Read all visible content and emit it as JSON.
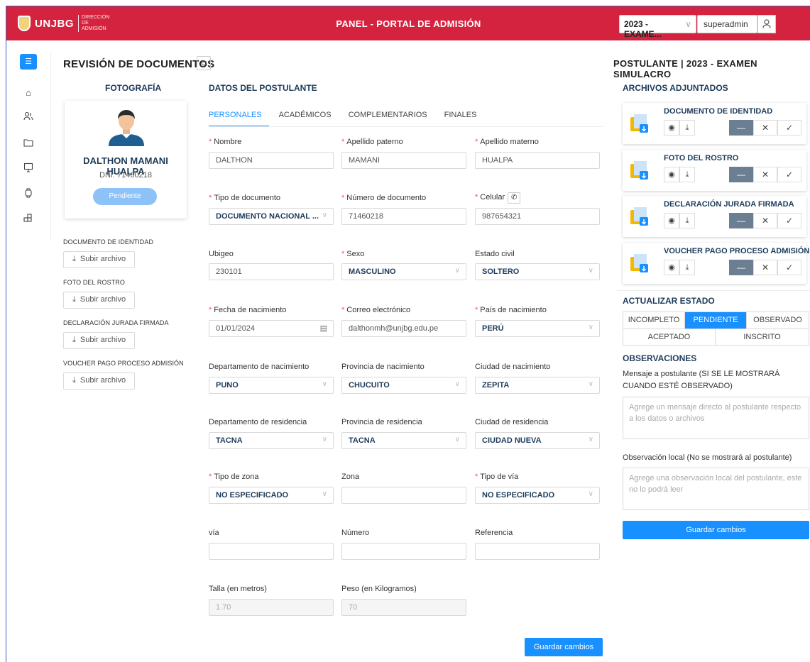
{
  "header": {
    "logo_text": "UNJBG",
    "logo_sub": "DIRECCIÓN DE ADMISIÓN",
    "title": "PANEL - PORTAL DE ADMISIÓN",
    "process_select": "2023 - EXAME...",
    "user": "superadmin"
  },
  "page": {
    "title": "REVISIÓN DE DOCUMENTOS",
    "photo_heading": "FOTOGRAFÍA",
    "data_heading": "DATOS DEL POSTULANTE"
  },
  "student": {
    "name": "DALTHON MAMANI HUALPA",
    "dni": "DNI: 71460218",
    "status": "Pendiente"
  },
  "uploads": [
    {
      "label": "DOCUMENTO DE IDENTIDAD",
      "button": "Subir archivo"
    },
    {
      "label": "FOTO DEL ROSTRO",
      "button": "Subir archivo"
    },
    {
      "label": "DECLARACIÓN JURADA FIRMADA",
      "button": "Subir archivo"
    },
    {
      "label": "VOUCHER PAGO PROCESO ADMISIÓN",
      "button": "Subir archivo"
    }
  ],
  "tabs": [
    "PERSONALES",
    "ACADÉMICOS",
    "COMPLEMENTARIOS",
    "FINALES"
  ],
  "form": {
    "nombre": {
      "label": "Nombre",
      "value": "DALTHON"
    },
    "apellido_paterno": {
      "label": "Apellido paterno",
      "value": "MAMANI"
    },
    "apellido_materno": {
      "label": "Apellido materno",
      "value": "HUALPA"
    },
    "tipo_documento": {
      "label": "Tipo de documento",
      "value": "DOCUMENTO NACIONAL ..."
    },
    "numero_documento": {
      "label": "Número de documento",
      "value": "71460218"
    },
    "celular": {
      "label": "Celular",
      "value": "987654321"
    },
    "ubigeo": {
      "label": "Ubigeo",
      "value": "230101"
    },
    "sexo": {
      "label": "Sexo",
      "value": "MASCULINO"
    },
    "estado_civil": {
      "label": "Estado civil",
      "value": "SOLTERO"
    },
    "fecha_nacimiento": {
      "label": "Fecha de nacimiento",
      "value": "01/01/2024"
    },
    "correo": {
      "label": "Correo electrónico",
      "value": "dalthonmh@unjbg.edu.pe"
    },
    "pais_nacimiento": {
      "label": "País de nacimiento",
      "value": "PERÚ"
    },
    "depto_nacimiento": {
      "label": "Departamento de nacimiento",
      "value": "PUNO"
    },
    "prov_nacimiento": {
      "label": "Provincia de nacimiento",
      "value": "CHUCUITO"
    },
    "ciudad_nacimiento": {
      "label": "Ciudad de nacimiento",
      "value": "ZEPITA"
    },
    "depto_residencia": {
      "label": "Departamento de residencia",
      "value": "TACNA"
    },
    "prov_residencia": {
      "label": "Provincia de residencia",
      "value": "TACNA"
    },
    "ciudad_residencia": {
      "label": "Ciudad de residencia",
      "value": "CIUDAD NUEVA"
    },
    "tipo_zona": {
      "label": "Tipo de zona",
      "value": "NO ESPECIFICADO"
    },
    "zona": {
      "label": "Zona",
      "value": ""
    },
    "tipo_via": {
      "label": "Tipo de vía",
      "value": "NO ESPECIFICADO"
    },
    "via": {
      "label": "vía",
      "value": ""
    },
    "numero": {
      "label": "Número",
      "value": ""
    },
    "referencia": {
      "label": "Referencia",
      "value": ""
    },
    "talla": {
      "label": "Talla (en metros)",
      "value": "1.70"
    },
    "peso": {
      "label": "Peso (en Kilogramos)",
      "value": "70"
    },
    "save": "Guardar cambios"
  },
  "right": {
    "title": "POSTULANTE | 2023 - EXAMEN SIMULACRO",
    "files_heading": "ARCHIVOS ADJUNTADOS",
    "files": [
      "DOCUMENTO DE IDENTIDAD",
      "FOTO DEL ROSTRO",
      "DECLARACIÓN JURADA FIRMADA",
      "VOUCHER PAGO PROCESO ADMISIÓN"
    ],
    "update_heading": "ACTUALIZAR ESTADO",
    "states": [
      "INCOMPLETO",
      "PENDIENTE",
      "OBSERVADO",
      "ACEPTADO",
      "INSCRITO"
    ],
    "active_state": "PENDIENTE",
    "obs_heading": "OBSERVACIONES",
    "msg_label": "Mensaje a postulante (SI SE LE MOSTRARÁ CUANDO ESTÉ OBSERVADO)",
    "msg_placeholder": "Agrege un mensaje directo al postulante respecto a los datos o archivos",
    "local_label": "Observación local (No se mostrará al postulante)",
    "local_placeholder": "Agrege una observación local del postulante, este no lo podrá leer",
    "save": "Guardar cambios"
  },
  "colors": {
    "header": "#d3233f",
    "primary": "#1890ff",
    "dark_button": "#6c7e91"
  }
}
